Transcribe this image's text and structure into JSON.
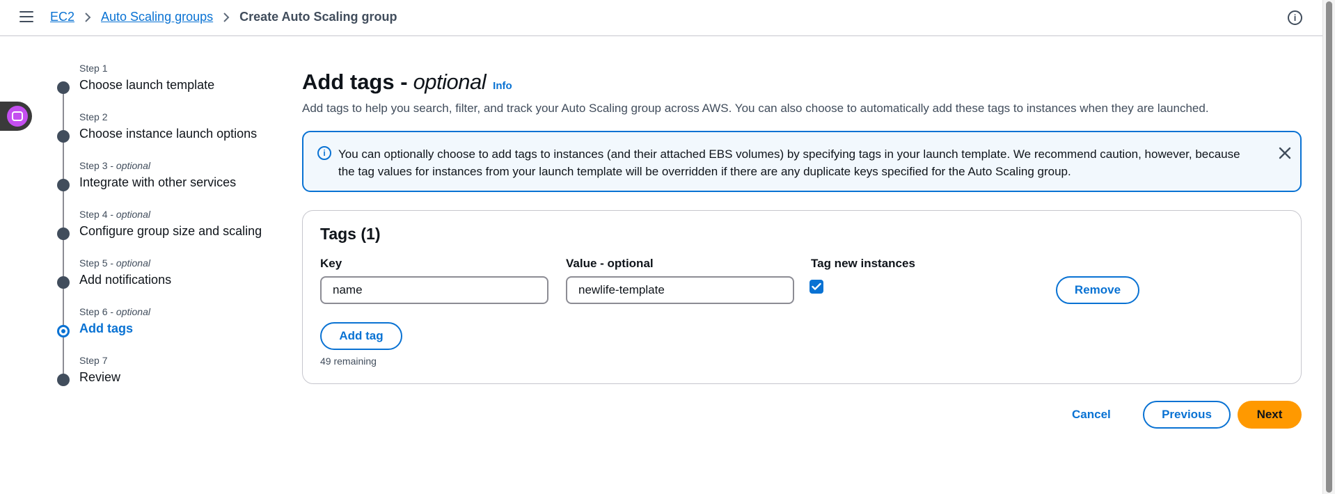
{
  "breadcrumb": {
    "items": [
      "EC2",
      "Auto Scaling groups"
    ],
    "current": "Create Auto Scaling group"
  },
  "steps": [
    {
      "num": "Step 1",
      "optional": "",
      "label": "Choose launch template"
    },
    {
      "num": "Step 2",
      "optional": "",
      "label": "Choose instance launch options"
    },
    {
      "num": "Step 3 - ",
      "optional": "optional",
      "label": "Integrate with other services"
    },
    {
      "num": "Step 4 - ",
      "optional": "optional",
      "label": "Configure group size and scaling"
    },
    {
      "num": "Step 5 - ",
      "optional": "optional",
      "label": "Add notifications"
    },
    {
      "num": "Step 6 - ",
      "optional": "optional",
      "label": "Add tags"
    },
    {
      "num": "Step 7",
      "optional": "",
      "label": "Review"
    }
  ],
  "page": {
    "title": "Add tags -",
    "title_optional": "optional",
    "info_link": "Info",
    "description": "Add tags to help you search, filter, and track your Auto Scaling group across AWS. You can also choose to automatically add these tags to instances when they are launched."
  },
  "alert": {
    "text": "You can optionally choose to add tags to instances (and their attached EBS volumes) by specifying tags in your launch template. We recommend caution, however, because the tag values for instances from your launch template will be overridden if there are any duplicate keys specified for the Auto Scaling group."
  },
  "tags_panel": {
    "title": "Tags (1)",
    "key_label": "Key",
    "value_label": "Value - optional",
    "tag_new_label": "Tag new instances",
    "key_value": "name",
    "value_value": "newlife-template",
    "remove_label": "Remove",
    "add_tag_label": "Add tag",
    "remaining": "49 remaining"
  },
  "actions": {
    "cancel": "Cancel",
    "previous": "Previous",
    "next": "Next"
  },
  "colors": {
    "accent": "#0972d3",
    "primary_button": "#ff9900",
    "alert_bg": "#f2f8fd"
  }
}
